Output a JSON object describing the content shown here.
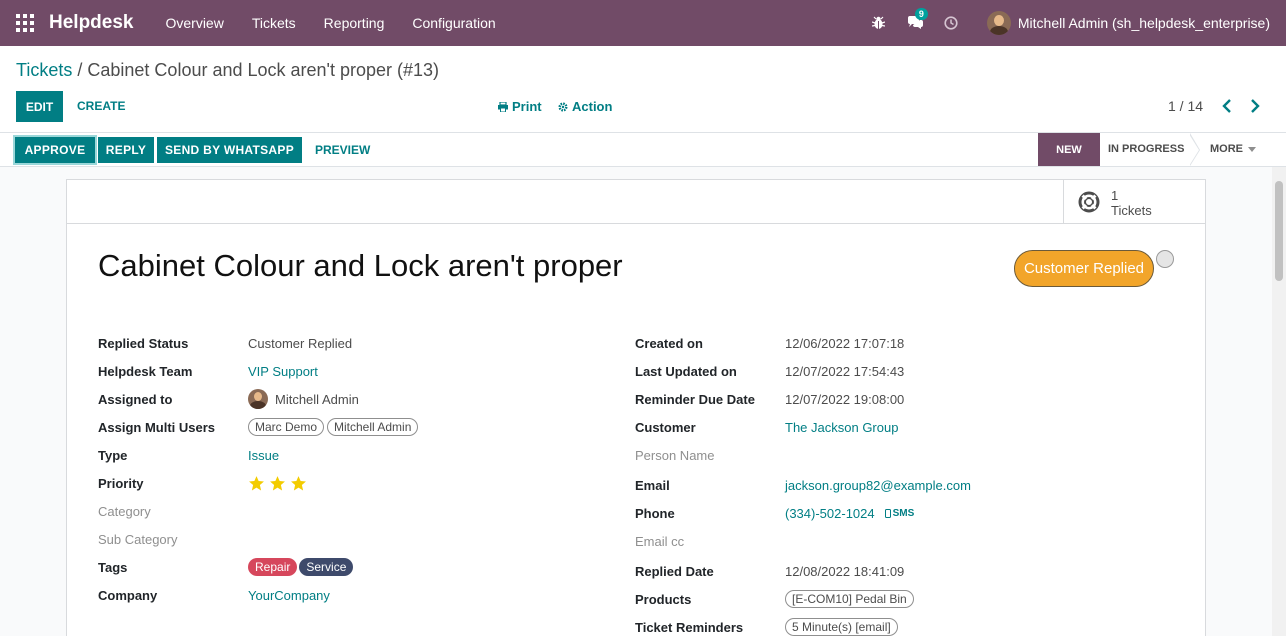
{
  "navbar": {
    "brand": "Helpdesk",
    "menu": [
      "Overview",
      "Tickets",
      "Reporting",
      "Configuration"
    ],
    "chat_count": "9",
    "user": "Mitchell Admin (sh_helpdesk_enterprise)"
  },
  "breadcrumb": {
    "root": "Tickets",
    "separator": "/",
    "current": "Cabinet Colour and Lock aren't proper (#13)"
  },
  "toolbar": {
    "edit": "EDIT",
    "create": "CREATE",
    "print": "Print",
    "action": "Action",
    "pager": "1 / 14"
  },
  "statusbar": {
    "approve": "APPROVE",
    "reply": "REPLY",
    "whatsapp": "SEND BY WHATSAPP",
    "preview": "PREVIEW",
    "stages": [
      "NEW",
      "IN PROGRESS",
      "MORE"
    ],
    "active_stage": "NEW"
  },
  "smart_button": {
    "count": "1",
    "label": "Tickets"
  },
  "ticket": {
    "title": "Cabinet Colour and Lock aren't proper",
    "status_pill": "Customer Replied",
    "left": {
      "replied_status": {
        "label": "Replied Status",
        "value": "Customer Replied"
      },
      "team": {
        "label": "Helpdesk Team",
        "value": "VIP Support"
      },
      "assigned": {
        "label": "Assigned to",
        "value": "Mitchell Admin"
      },
      "multi_users": {
        "label": "Assign Multi Users",
        "values": [
          "Marc Demo",
          "Mitchell Admin"
        ]
      },
      "type": {
        "label": "Type",
        "value": "Issue"
      },
      "priority": {
        "label": "Priority",
        "stars": 3
      },
      "category": {
        "label": "Category"
      },
      "sub_category": {
        "label": "Sub Category"
      },
      "tags": {
        "label": "Tags",
        "values": [
          "Repair",
          "Service"
        ]
      },
      "company": {
        "label": "Company",
        "value": "YourCompany"
      }
    },
    "right": {
      "created_on": {
        "label": "Created on",
        "value": "12/06/2022 17:07:18"
      },
      "last_updated": {
        "label": "Last Updated on",
        "value": "12/07/2022 17:54:43"
      },
      "reminder_due": {
        "label": "Reminder Due Date",
        "value": "12/07/2022 19:08:00"
      },
      "customer": {
        "label": "Customer",
        "value": "The Jackson Group"
      },
      "person_name": {
        "label": "Person Name"
      },
      "email": {
        "label": "Email",
        "value": "jackson.group82@example.com"
      },
      "phone": {
        "label": "Phone",
        "value": "(334)-502-1024",
        "sms": "SMS"
      },
      "email_cc": {
        "label": "Email cc"
      },
      "replied_date": {
        "label": "Replied Date",
        "value": "12/08/2022 18:41:09"
      },
      "products": {
        "label": "Products",
        "value": "[E-COM10] Pedal Bin"
      },
      "reminders": {
        "label": "Ticket Reminders",
        "value": "5 Minute(s) [email]"
      }
    }
  },
  "colors": {
    "primary": "#714B67",
    "accent": "#017e84",
    "pill": "#f2a52a",
    "tag_repair": "#d6475c",
    "tag_service": "#3e4a6b",
    "star": "#f3cc00"
  }
}
